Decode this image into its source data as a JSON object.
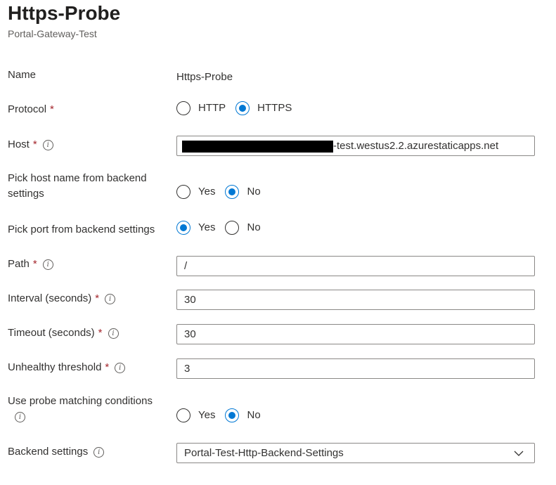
{
  "header": {
    "title": "Https-Probe",
    "subtitle": "Portal-Gateway-Test"
  },
  "form": {
    "name": {
      "label": "Name",
      "value": "Https-Probe"
    },
    "protocol": {
      "label": "Protocol",
      "required_mark": "*",
      "options": [
        "HTTP",
        "HTTPS"
      ],
      "selected": "HTTPS"
    },
    "host": {
      "label": "Host",
      "required_mark": "*",
      "info_glyph": "i",
      "value_visible_suffix": "-test.westus2.2.azurestaticapps.net"
    },
    "pick_host": {
      "label": "Pick host name from backend settings",
      "options": [
        "Yes",
        "No"
      ],
      "selected": "No"
    },
    "pick_port": {
      "label": "Pick port from backend settings",
      "options": [
        "Yes",
        "No"
      ],
      "selected": "Yes"
    },
    "path": {
      "label": "Path",
      "required_mark": "*",
      "info_glyph": "i",
      "value": "/"
    },
    "interval": {
      "label": "Interval (seconds)",
      "required_mark": "*",
      "info_glyph": "i",
      "value": "30"
    },
    "timeout": {
      "label": "Timeout (seconds)",
      "required_mark": "*",
      "info_glyph": "i",
      "value": "30"
    },
    "unhealthy": {
      "label": "Unhealthy threshold",
      "required_mark": "*",
      "info_glyph": "i",
      "value": "3"
    },
    "matching": {
      "label": "Use probe matching conditions",
      "info_glyph": "i",
      "options": [
        "Yes",
        "No"
      ],
      "selected": "No"
    },
    "backend_settings": {
      "label": "Backend settings",
      "info_glyph": "i",
      "value": "Portal-Test-Http-Backend-Settings",
      "icon": "chevron-down-icon"
    }
  },
  "colors": {
    "accent": "#0078d4",
    "required": "#a4262c",
    "border": "#8a8886"
  }
}
